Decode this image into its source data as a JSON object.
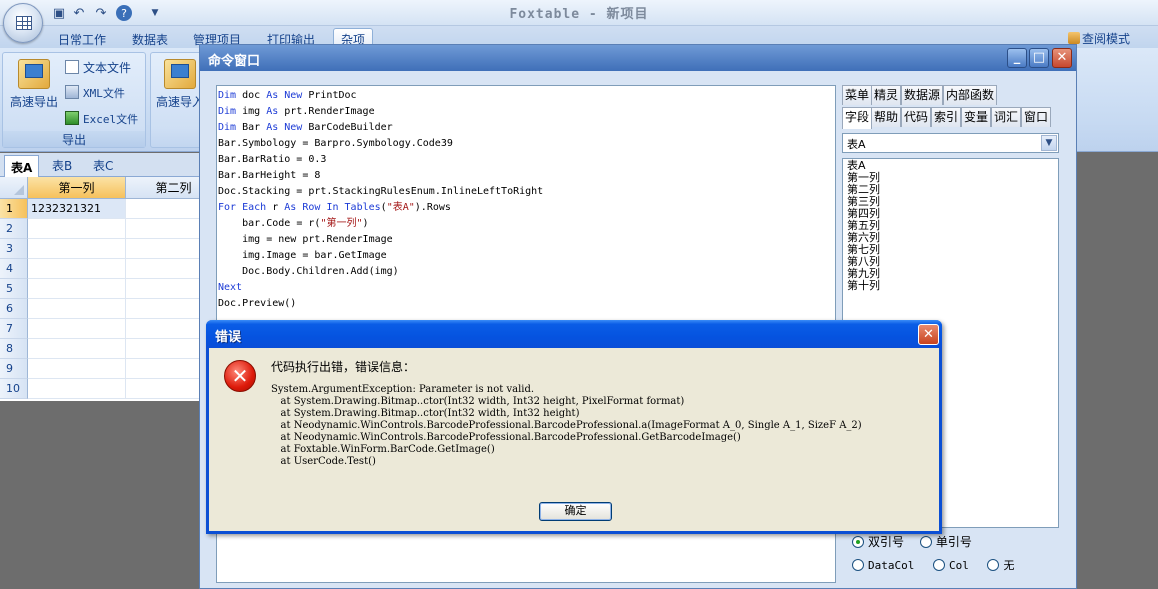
{
  "app": {
    "title": "Foxtable - 新项目",
    "quick_access": [
      "save-icon",
      "undo-icon",
      "redo-icon",
      "help-icon",
      "dropdown-icon"
    ]
  },
  "ribbon": {
    "tabs": [
      "日常工作",
      "数据表",
      "管理项目",
      "打印输出",
      "杂项"
    ],
    "active_tab": "杂项",
    "view_mode": "查阅模式",
    "export_group": {
      "big_button": "高速导出",
      "text_file": "文本文件",
      "xml_file": "XML文件",
      "excel_file": "Excel文件",
      "label": "导出"
    },
    "import_group": {
      "big_button": "高速导入"
    }
  },
  "sheets": {
    "tabs": [
      "表A",
      "表B",
      "表C"
    ],
    "active": "表A",
    "columns": [
      "第一列",
      "第二列"
    ],
    "rows": [
      "1",
      "2",
      "3",
      "4",
      "5",
      "6",
      "7",
      "8",
      "9",
      "10"
    ],
    "first_cell": "1232321321"
  },
  "command_window": {
    "title": "命令窗口",
    "controls": {
      "minimize": "_",
      "maximize": "□",
      "close": "✕"
    },
    "code_lines": [
      "Dim doc As New PrintDoc",
      "Dim img As prt.RenderImage",
      "Dim Bar As New BarCodeBuilder",
      "Bar.Symbology = Barpro.Symbology.Code39",
      "Bar.BarRatio = 0.3",
      "Bar.BarHeight = 8",
      "Doc.Stacking = prt.StackingRulesEnum.InlineLeftToRight",
      "For Each r As Row In Tables(\"表A\").Rows",
      "    bar.Code = r(\"第一列\")",
      "    img = new prt.RenderImage",
      "    img.Image = bar.GetImage",
      "    Doc.Body.Children.Add(img)",
      "Next",
      "Doc.Preview()"
    ],
    "side_tabs_row1": [
      "菜单",
      "精灵",
      "数据源",
      "内部函数"
    ],
    "side_tabs_row2": [
      "字段",
      "帮助",
      "代码",
      "索引",
      "变量",
      "词汇",
      "窗口"
    ],
    "active_side_tab": "字段",
    "table_select": "表A",
    "field_list": [
      "表A",
      "第一列",
      "第二列",
      "第三列",
      "第四列",
      "第五列",
      "第六列",
      "第七列",
      "第八列",
      "第九列",
      "第十列"
    ],
    "quote_options": {
      "double": "双引号",
      "single": "单引号",
      "selected": "双引号"
    },
    "insert_options": {
      "datacol": "DataCol",
      "col": "Col",
      "none": "无",
      "selected": "DataCol"
    }
  },
  "error_dialog": {
    "title": "错误",
    "close": "✕",
    "icon": "error-icon",
    "heading": "代码执行出错，错误信息：",
    "details": [
      "System.ArgumentException: Parameter is not valid.",
      "   at System.Drawing.Bitmap..ctor(Int32 width, Int32 height, PixelFormat format)",
      "   at System.Drawing.Bitmap..ctor(Int32 width, Int32 height)",
      "   at Neodynamic.WinControls.BarcodeProfessional.BarcodeProfessional.a(ImageFormat A_0, Single A_1, SizeF A_2)",
      "   at Neodynamic.WinControls.BarcodeProfessional.BarcodeProfessional.GetBarcodeImage()",
      "   at Foxtable.WinForm.BarCode.GetImage()",
      "   at UserCode.Test()"
    ],
    "ok": "确定"
  }
}
